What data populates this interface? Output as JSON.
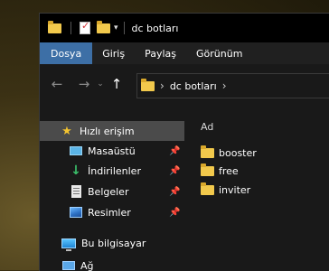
{
  "window": {
    "title": "dc botları"
  },
  "ribbon": {
    "tabs": [
      {
        "label": "Dosya",
        "active": true
      },
      {
        "label": "Giriş",
        "active": false
      },
      {
        "label": "Paylaş",
        "active": false
      },
      {
        "label": "Görünüm",
        "active": false
      }
    ]
  },
  "address": {
    "path": "dc botları"
  },
  "sidebar": {
    "items": [
      {
        "label": "Hızlı erişim",
        "icon": "star-icon",
        "selected": true
      },
      {
        "label": "Masaüstü",
        "icon": "desktop-icon",
        "pinned": true
      },
      {
        "label": "İndirilenler",
        "icon": "download-icon",
        "pinned": true
      },
      {
        "label": "Belgeler",
        "icon": "documents-icon",
        "pinned": true
      },
      {
        "label": "Resimler",
        "icon": "pictures-icon",
        "pinned": true
      },
      {
        "label": "Bu bilgisayar",
        "icon": "this-pc-icon"
      },
      {
        "label": "Ağ",
        "icon": "network-icon"
      }
    ]
  },
  "content": {
    "column_header": "Ad",
    "files": [
      {
        "name": "booster",
        "icon": "folder-icon"
      },
      {
        "name": "free",
        "icon": "folder-icon"
      },
      {
        "name": "inviter",
        "icon": "folder-icon"
      }
    ]
  },
  "colors": {
    "accent_tab": "#3d6fa6",
    "folder": "#f2c94c",
    "selected_nav": "#4b4b4b",
    "window_bg": "#191919"
  }
}
